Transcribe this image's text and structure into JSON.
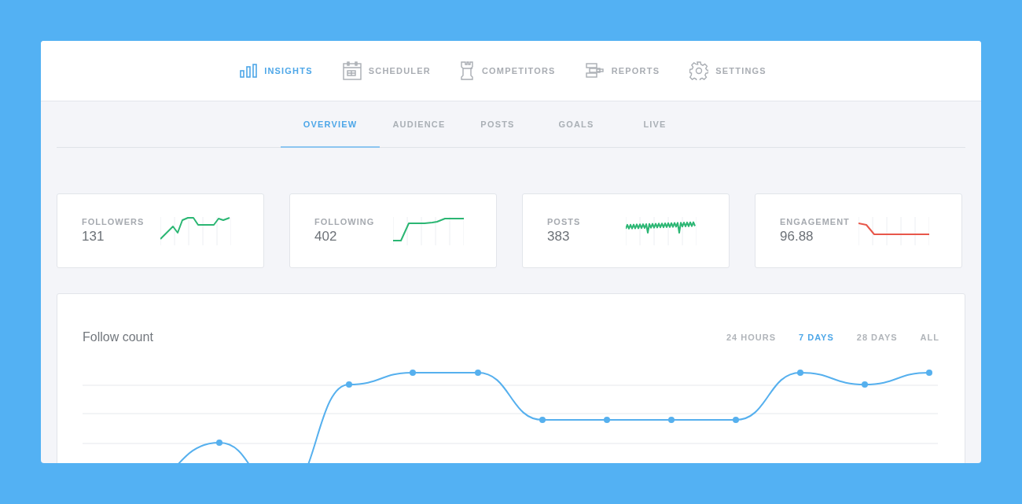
{
  "nav": {
    "items": [
      {
        "label": "INSIGHTS",
        "kind": "bars",
        "selected": true
      },
      {
        "label": "SCHEDULER",
        "kind": "calendar",
        "selected": false
      },
      {
        "label": "COMPETITORS",
        "kind": "rook",
        "selected": false
      },
      {
        "label": "REPORTS",
        "kind": "stack",
        "selected": false
      },
      {
        "label": "SETTINGS",
        "kind": "gear",
        "selected": false
      }
    ]
  },
  "subtabs": [
    {
      "label": "OVERVIEW",
      "selected": true
    },
    {
      "label": "AUDIENCE",
      "selected": false
    },
    {
      "label": "POSTS",
      "selected": false
    },
    {
      "label": "GOALS",
      "selected": false
    },
    {
      "label": "LIVE",
      "selected": false
    }
  ],
  "stats": [
    {
      "label": "FOLLOWERS",
      "value": "131",
      "color": "#2bb673"
    },
    {
      "label": "FOLLOWING",
      "value": "402",
      "color": "#2bb673"
    },
    {
      "label": "POSTS",
      "value": "383",
      "color": "#2bb673"
    },
    {
      "label": "ENGAGEMENT",
      "value": "96.88",
      "color": "#e8574a"
    }
  ],
  "follow_chart": {
    "title": "Follow count",
    "ranges": [
      {
        "label": "24 HOURS",
        "selected": false
      },
      {
        "label": "7 DAYS",
        "selected": true
      },
      {
        "label": "28 DAYS",
        "selected": false
      },
      {
        "label": "ALL",
        "selected": false
      }
    ]
  }
}
